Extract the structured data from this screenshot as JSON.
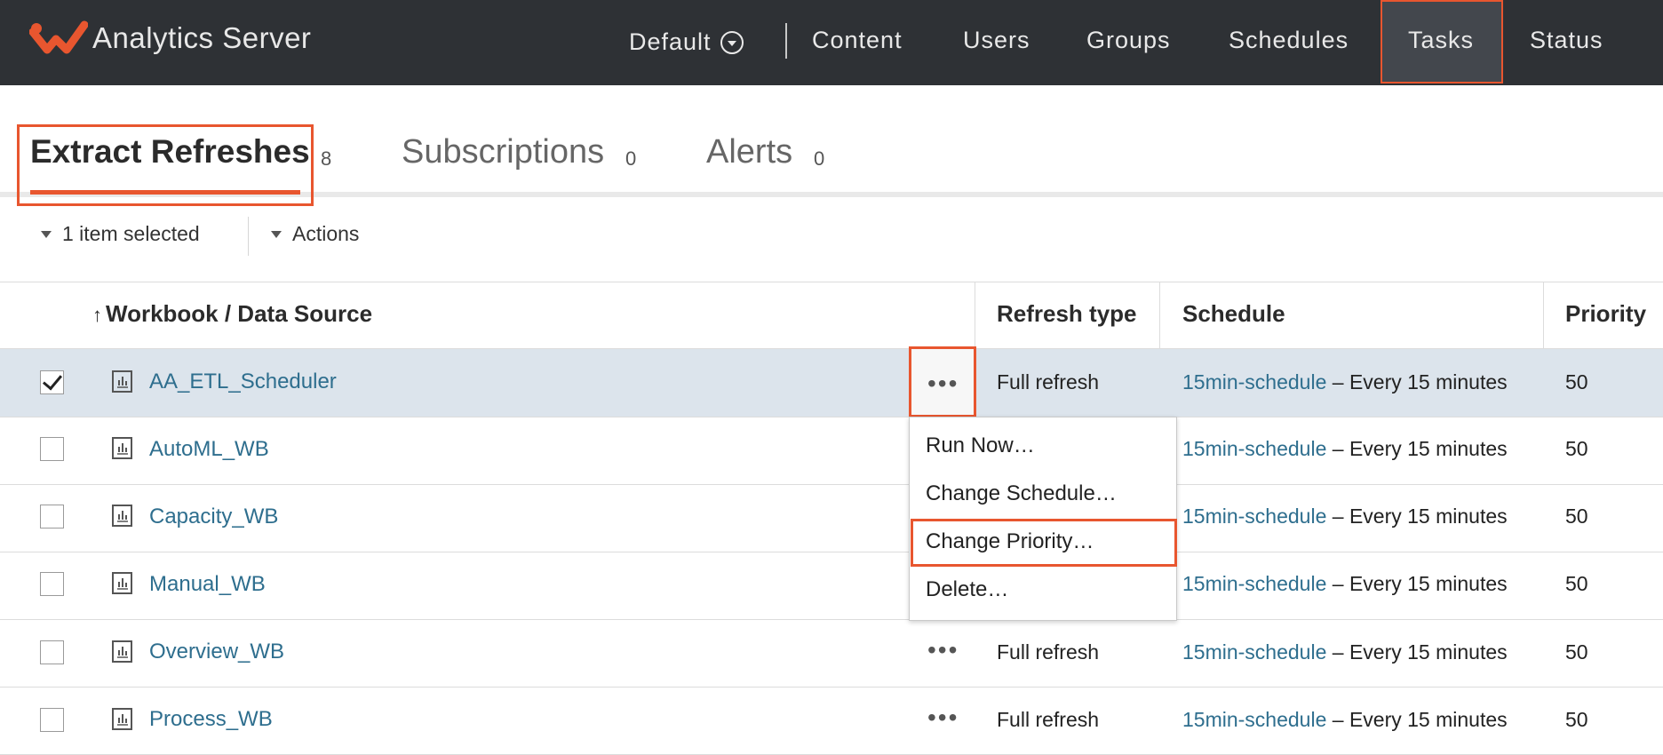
{
  "app": {
    "brand": "Analytics Server",
    "accent_color": "#e8562f",
    "link_color": "#2e6e8e"
  },
  "nav": {
    "site": "Default",
    "items": [
      {
        "label": "Content"
      },
      {
        "label": "Users"
      },
      {
        "label": "Groups"
      },
      {
        "label": "Schedules"
      },
      {
        "label": "Tasks"
      },
      {
        "label": "Status"
      }
    ],
    "active": "Tasks"
  },
  "tabs": [
    {
      "label": "Extract Refreshes",
      "count": "8"
    },
    {
      "label": "Subscriptions",
      "count": "0"
    },
    {
      "label": "Alerts",
      "count": "0"
    }
  ],
  "toolbar": {
    "selection": "1 item selected",
    "actions": "Actions"
  },
  "table": {
    "columns": [
      {
        "label": "Workbook / Data Source",
        "sort_icon": "sort-ascending-icon"
      },
      {
        "label": "Refresh type"
      },
      {
        "label": "Schedule"
      },
      {
        "label": "Priority"
      }
    ],
    "rows": [
      {
        "name": "AA_ETL_Scheduler",
        "refresh_type": "Full refresh",
        "schedule_link": "15min-schedule",
        "schedule_detail": "– Every 15 minutes",
        "priority": "50"
      },
      {
        "name": "AutoML_WB",
        "refresh_type": "",
        "schedule_link": "15min-schedule",
        "schedule_detail": "– Every 15 minutes",
        "priority": "50"
      },
      {
        "name": "Capacity_WB",
        "refresh_type": "",
        "schedule_link": "15min-schedule",
        "schedule_detail": "– Every 15 minutes",
        "priority": "50"
      },
      {
        "name": "Manual_WB",
        "refresh_type": "",
        "schedule_link": "15min-schedule",
        "schedule_detail": "– Every 15 minutes",
        "priority": "50"
      },
      {
        "name": "Overview_WB",
        "refresh_type": "Full refresh",
        "schedule_link": "15min-schedule",
        "schedule_detail": "– Every 15 minutes",
        "priority": "50"
      },
      {
        "name": "Process_WB",
        "refresh_type": "Full refresh",
        "schedule_link": "15min-schedule",
        "schedule_detail": "– Every 15 minutes",
        "priority": "50"
      }
    ],
    "more_glyph": "•••"
  },
  "context_menu": {
    "items": [
      {
        "label": "Run Now…"
      },
      {
        "label": "Change Schedule…"
      },
      {
        "label": "Change Priority…"
      },
      {
        "label": "Delete…"
      }
    ]
  }
}
